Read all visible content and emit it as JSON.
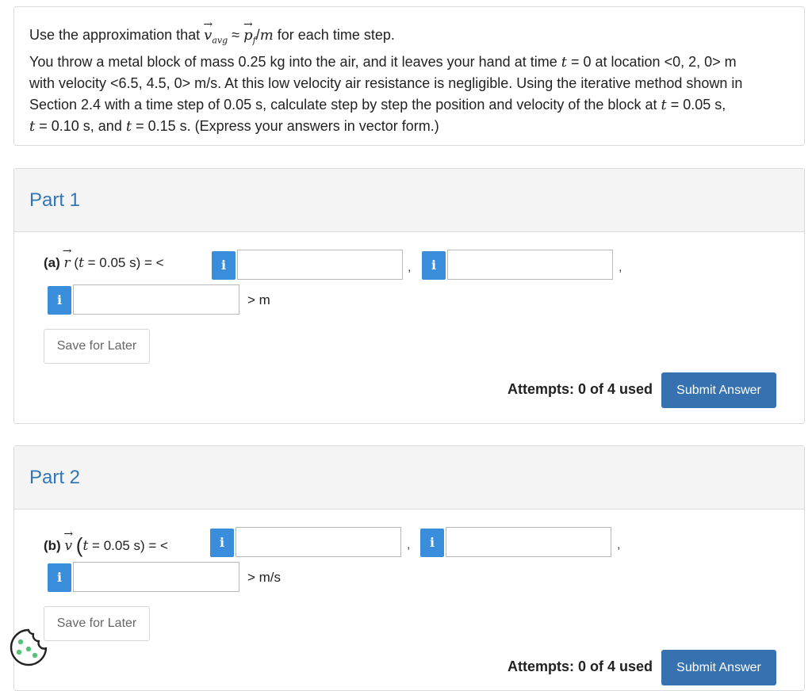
{
  "question": {
    "line1_prefix": "Use the approximation that",
    "approx_sym": "≈",
    "line1_suffix": "for each time step.",
    "v_symbol": "v",
    "v_sub": "avg",
    "p_symbol": "p",
    "p_sub": "f",
    "mass_symbol": "m",
    "line2": "You throw a metal block of mass 0.25 kg into the air, and it leaves your hand at time",
    "line2_t": "t",
    "line2_eq": "= 0 at location <0, 2, 0> m",
    "line3": "with velocity <6.5, 4.5, 0> m/s. At this low velocity air resistance is negligible. Using the iterative method shown in",
    "line4": "Section 2.4 with a time step of 0.05 s, calculate step by step the position and velocity of the block at",
    "line4_t": "t",
    "line4_eq": "= 0.05 s,",
    "line5_t1": "t",
    "line5_eq1": "= 0.10 s, and",
    "line5_t2": "t",
    "line5_eq2": "= 0.15 s. (Express your answers in vector form.)"
  },
  "parts": [
    {
      "title": "Part 1",
      "label_prefix": "(a)",
      "symbol": "r",
      "t_sym": "t",
      "time": "= 0.05 s)",
      "open": "(",
      "rhs": "= <",
      "info": "i",
      "comma": ",",
      "unit": "> m",
      "save_label": "Save for Later",
      "attempts": "Attempts: 0 of 4 used",
      "submit_label": "Submit Answer"
    },
    {
      "title": "Part 2",
      "label_prefix": "(b)",
      "symbol": "v",
      "t_sym": "t",
      "time": "= 0.05 s)",
      "open": "(",
      "rhs": "= <",
      "info": "i",
      "comma": ",",
      "unit": "> m/s",
      "save_label": "Save for Later",
      "attempts": "Attempts: 0 of 4 used",
      "submit_label": "Submit Answer"
    }
  ],
  "colors": {
    "accent": "#3176b6",
    "info_button": "#3a8ddb",
    "submit_button": "#3672b0",
    "cookie": "#55c27a"
  },
  "icons": {
    "info": "info-icon",
    "cookie": "cookie-icon"
  }
}
